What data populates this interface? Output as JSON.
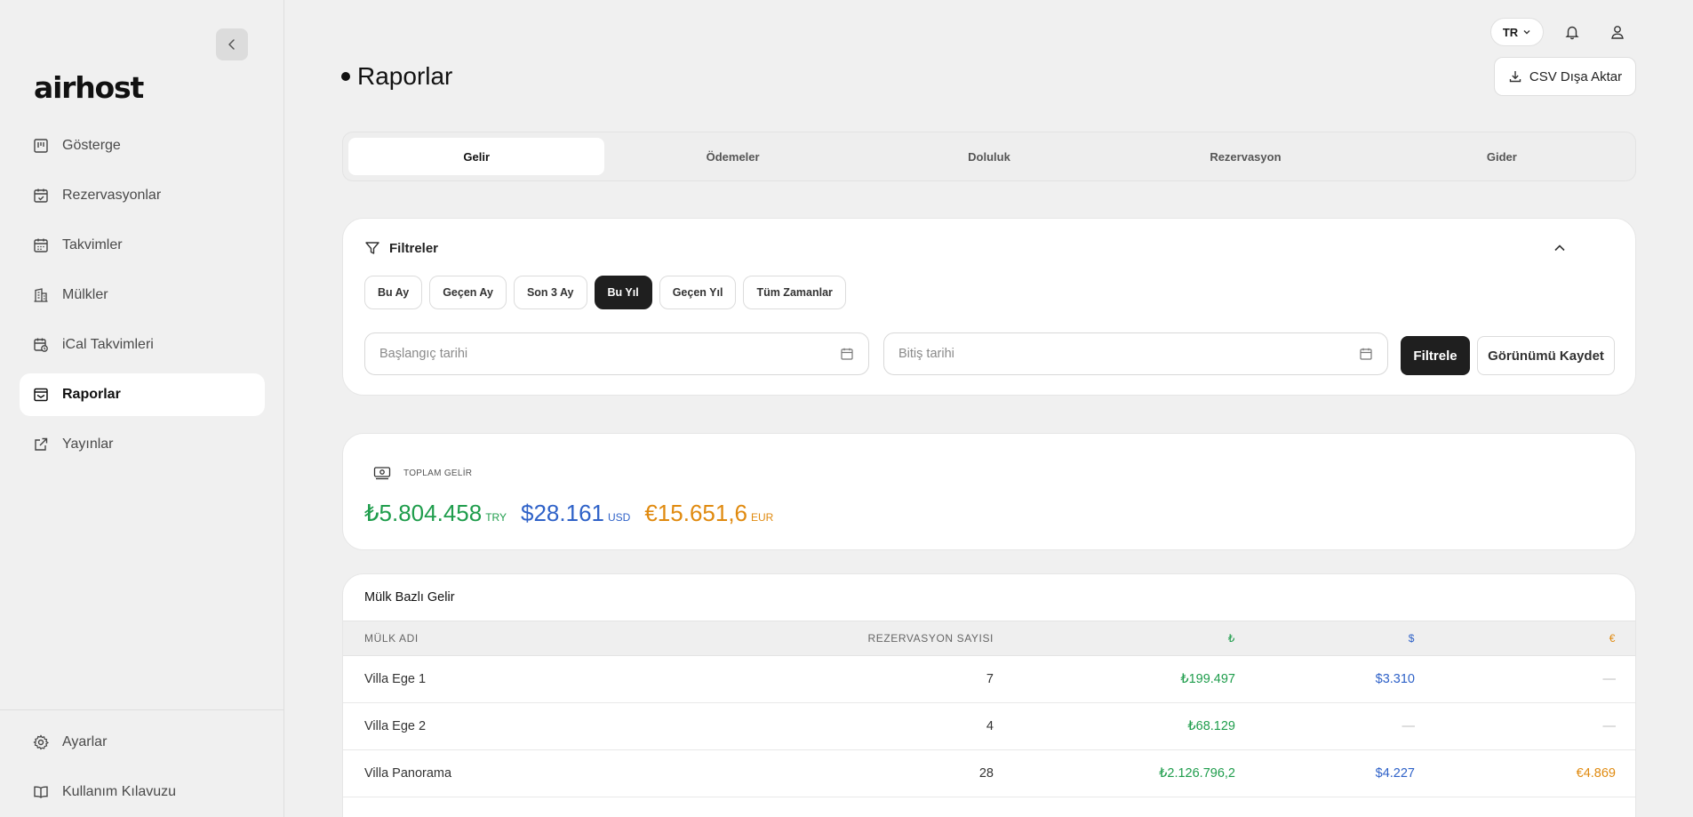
{
  "brand": {
    "logo": "airhost"
  },
  "sidebar": {
    "items": [
      {
        "label": "Gösterge",
        "icon": "dashboard-icon"
      },
      {
        "label": "Rezervasyonlar",
        "icon": "calendar-check-icon"
      },
      {
        "label": "Takvimler",
        "icon": "calendar-icon"
      },
      {
        "label": "Mülkler",
        "icon": "building-icon"
      },
      {
        "label": "iCal Takvimleri",
        "icon": "calendar-sync-icon"
      },
      {
        "label": "Raporlar",
        "icon": "reports-icon",
        "active": true
      },
      {
        "label": "Yayınlar",
        "icon": "external-link-icon"
      }
    ],
    "bottom": [
      {
        "label": "Ayarlar",
        "icon": "gear-icon"
      },
      {
        "label": "Kullanım Kılavuzu",
        "icon": "book-icon"
      }
    ]
  },
  "topbar": {
    "language": "TR"
  },
  "page": {
    "title": "Raporlar",
    "export_label": "CSV Dışa Aktar"
  },
  "tabs": [
    {
      "label": "Gelir",
      "active": true
    },
    {
      "label": "Ödemeler"
    },
    {
      "label": "Doluluk"
    },
    {
      "label": "Rezervasyon"
    },
    {
      "label": "Gider"
    }
  ],
  "filters": {
    "title": "Filtreler",
    "presets": [
      {
        "label": "Bu Ay"
      },
      {
        "label": "Geçen Ay"
      },
      {
        "label": "Son 3 Ay"
      },
      {
        "label": "Bu Yıl",
        "active": true
      },
      {
        "label": "Geçen Yıl"
      },
      {
        "label": "Tüm Zamanlar"
      }
    ],
    "start_placeholder": "Başlangıç tarihi",
    "end_placeholder": "Bitiş tarihi",
    "filter_button": "Filtrele",
    "save_view_button": "Görünümü Kaydet"
  },
  "totals": {
    "label": "TOPLAM GELİR",
    "try_amount": "₺5.804.458",
    "try_code": "TRY",
    "usd_amount": "$28.161",
    "usd_code": "USD",
    "eur_amount": "€15.651,6",
    "eur_code": "EUR"
  },
  "table": {
    "title": "Mülk Bazlı Gelir",
    "headers": {
      "name": "MÜLK ADI",
      "count": "REZERVASYON SAYISI",
      "try": "₺",
      "usd": "$",
      "eur": "€"
    },
    "rows": [
      {
        "name": "Villa Ege 1",
        "count": "7",
        "try": "₺199.497",
        "usd": "$3.310",
        "eur": "—"
      },
      {
        "name": "Villa Ege 2",
        "count": "4",
        "try": "₺68.129",
        "usd": "—",
        "eur": "—"
      },
      {
        "name": "Villa Panorama",
        "count": "28",
        "try": "₺2.126.796,2",
        "usd": "$4.227",
        "eur": "€4.869"
      }
    ]
  },
  "colors": {
    "try": "#1f9d4c",
    "usd": "#2f62c8",
    "eur": "#e08a0f",
    "active_dark": "#1f1f1f"
  }
}
